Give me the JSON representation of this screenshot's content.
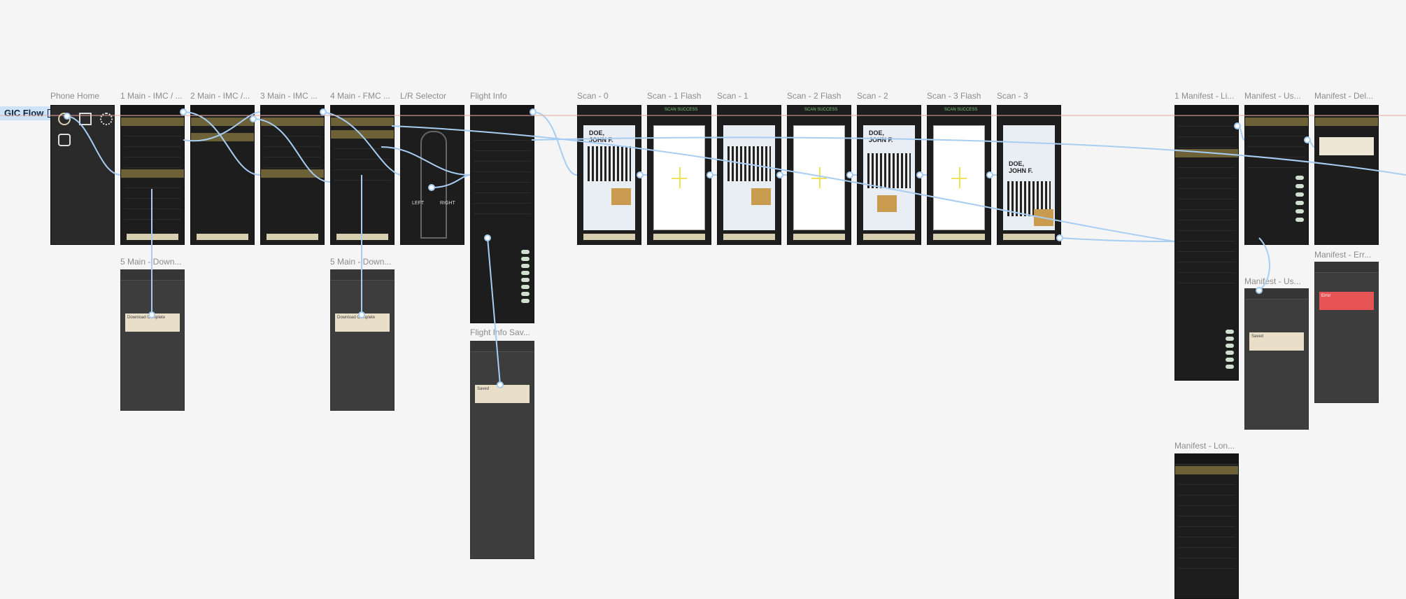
{
  "flow": {
    "title": "GIC Flow"
  },
  "frames": [
    {
      "id": "phone-home",
      "label": "Phone Home"
    },
    {
      "id": "main-imc-1",
      "label": "1 Main - IMC / ..."
    },
    {
      "id": "main-imc-2",
      "label": "2 Main - IMC /..."
    },
    {
      "id": "main-imc-3",
      "label": "3 Main - IMC ..."
    },
    {
      "id": "main-fmc-4",
      "label": "4 Main - FMC ..."
    },
    {
      "id": "lr-selector",
      "label": "L/R Selector"
    },
    {
      "id": "flight-info",
      "label": "Flight Info"
    },
    {
      "id": "scan-0",
      "label": "Scan - 0"
    },
    {
      "id": "scan-1-flash",
      "label": "Scan - 1 Flash"
    },
    {
      "id": "scan-1",
      "label": "Scan - 1"
    },
    {
      "id": "scan-2-flash",
      "label": "Scan - 2 Flash"
    },
    {
      "id": "scan-2",
      "label": "Scan - 2"
    },
    {
      "id": "scan-3-flash",
      "label": "Scan - 3 Flash"
    },
    {
      "id": "scan-3",
      "label": "Scan - 3"
    },
    {
      "id": "manifest-1",
      "label": "1 Manifest - Li..."
    },
    {
      "id": "manifest-us-1",
      "label": "Manifest - Us..."
    },
    {
      "id": "manifest-del",
      "label": "Manifest - Del..."
    },
    {
      "id": "main-down-5a",
      "label": "5 Main - Down..."
    },
    {
      "id": "main-down-5b",
      "label": "5 Main - Down..."
    },
    {
      "id": "flight-info-save",
      "label": "Flight Info Sav..."
    },
    {
      "id": "manifest-err",
      "label": "Manifest - Err..."
    },
    {
      "id": "manifest-us-2",
      "label": "Manifest - Us..."
    },
    {
      "id": "manifest-lon",
      "label": "Manifest - Lon..."
    }
  ],
  "mockup_text": {
    "lr_left": "LEFT",
    "lr_right": "RIGHT",
    "card_name": "DOE,\nJOHN F.",
    "scan_success": "SCAN SUCCESS",
    "download_complete": "Download Complete",
    "saved": "Saved",
    "error": "Error"
  },
  "colors": {
    "canvas": "#f5f5f5",
    "frame_bg": "#1d1d1d",
    "gold_band": "#6d6237",
    "accent_cream": "#d8ceb0",
    "wire": "#a8cdf2",
    "error_red": "#e5383b",
    "flow_label_bg": "#cfe3f7"
  }
}
